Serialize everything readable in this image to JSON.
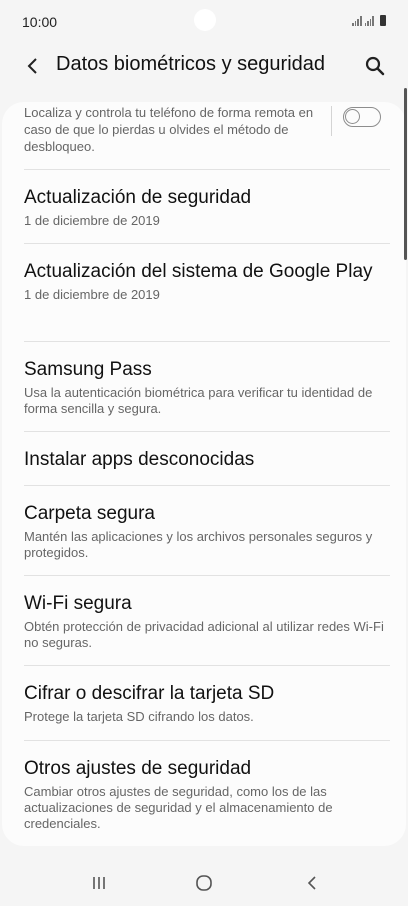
{
  "status_bar": {
    "time": "10:00"
  },
  "header": {
    "title": "Datos biométricos y seguridad",
    "back_icon": "chevron-left-icon",
    "search_icon": "search-icon"
  },
  "find_my_mobile": {
    "description": "Localiza y controla tu teléfono de forma remota en caso de que lo pierdas u olvides el método de desbloqueo.",
    "toggle_on": false
  },
  "items": [
    {
      "title": "Actualización de seguridad",
      "subtitle": "1 de diciembre de 2019"
    },
    {
      "title": "Actualización del sistema de Google Play",
      "subtitle": "1 de diciembre de 2019"
    },
    {
      "title": "Samsung Pass",
      "subtitle": "Usa la autenticación biométrica para verificar tu identidad de forma sencilla y segura."
    },
    {
      "title": "Instalar apps desconocidas",
      "subtitle": ""
    },
    {
      "title": "Carpeta segura",
      "subtitle": "Mantén las aplicaciones y los archivos personales seguros y protegidos."
    },
    {
      "title": "Wi-Fi segura",
      "subtitle": "Obtén protección de privacidad adicional al utilizar redes Wi-Fi no seguras."
    },
    {
      "title": "Cifrar o descifrar la tarjeta SD",
      "subtitle": "Protege la tarjeta SD cifrando los datos."
    },
    {
      "title": "Otros ajustes de seguridad",
      "subtitle": "Cambiar otros ajustes de seguridad, como los de las actualizaciones de seguridad y el almacenamiento de credenciales."
    }
  ],
  "nav_bar": {
    "recents_icon": "recents-icon",
    "home_icon": "home-icon",
    "back_icon": "back-icon"
  }
}
